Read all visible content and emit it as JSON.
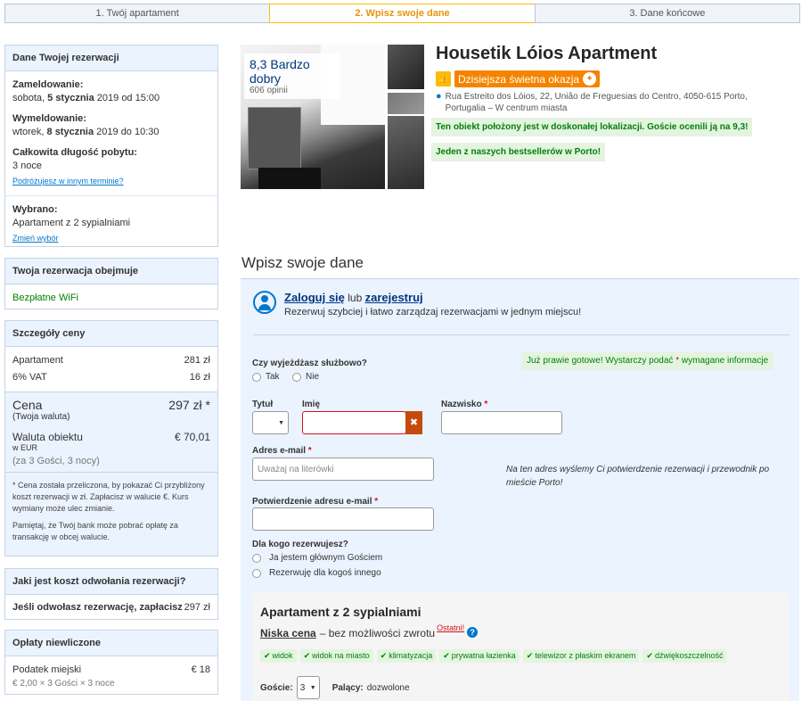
{
  "steps": [
    {
      "label": "1. Twój apartament"
    },
    {
      "label": "2. Wpisz swoje dane"
    },
    {
      "label": "3. Dane końcowe"
    }
  ],
  "reservation": {
    "title": "Dane Twojej rezerwacji",
    "checkin_label": "Zameldowanie:",
    "checkin_pre": "sobota, ",
    "checkin_date": "5 stycznia",
    "checkin_post": " 2019 od 15:00",
    "checkout_label": "Wymeldowanie:",
    "checkout_pre": "wtorek, ",
    "checkout_date": "8 stycznia",
    "checkout_post": " 2019 do 10:30",
    "length_label": "Całkowita długość pobytu:",
    "length_value": "3 noce",
    "other_dates_link": "Podróżujesz w innym terminie?",
    "chosen_label": "Wybrano:",
    "chosen_value": "Apartament z 2 sypialniami",
    "change_link": "Zmień wybór"
  },
  "includes": {
    "title": "Twoja rezerwacja obejmuje",
    "item": "Bezpłatne WiFi"
  },
  "price": {
    "title": "Szczegóły ceny",
    "rows": [
      {
        "label": "Apartament",
        "value": "281 zł"
      },
      {
        "label": "6% VAT",
        "value": "16 zł"
      }
    ],
    "total_label": "Cena",
    "total_sub": "(Twoja waluta)",
    "total_value": "297 zł *",
    "prop_currency_label": "Waluta obiektu",
    "prop_currency_sub": "w EUR",
    "prop_currency_value": "€ 70,01",
    "guests_nights": "(za 3 Gości, 3 nocy)",
    "note1": "* Cena została przeliczona, by pokazać Ci przybliżony koszt rezerwacji w zł. Zapłacisz w walucie €. Kurs wymiany może ulec zmianie.",
    "note2": "Pamiętaj, że Twój bank może pobrać opłatę za transakcję w obcej walucie."
  },
  "cancellation": {
    "title": "Jaki jest koszt odwołania rezerwacji?",
    "label": "Jeśli odwołasz rezerwację, zapłacisz",
    "value": "297 zł"
  },
  "fees": {
    "title": "Opłaty niewliczone",
    "label": "Podatek miejski",
    "value": "€ 18",
    "calc": "€ 2,00  ×  3 Gości  ×  3 noce"
  },
  "hotel": {
    "rating": "8,3 Bardzo dobry",
    "reviews": "606 opinii",
    "name": "Housetik Lóios Apartment",
    "deal": "Dzisiejsza świetna okazja",
    "address": "Rua Estreito dos Lóios, 22, União de Freguesias do Centro, 4050-615 Porto, Portugalia – W centrum miasta",
    "location_note": "Ten obiekt położony jest w doskonałej lokalizacji. Goście ocenili ją na 9,3!",
    "bestseller": "Jeden z naszych bestsellerów w Porto!"
  },
  "form": {
    "title": "Wpisz swoje dane",
    "login_link": "Zaloguj się",
    "or": " lub ",
    "register_link": "zarejestruj",
    "login_sub": "Rezerwuj szybciej i łatwo zarządzaj rezerwacjami w jednym miejscu!",
    "business_q": "Czy wyjeżdżasz służbowo?",
    "yes": "Tak",
    "no": "Nie",
    "ready_pre": "Już prawie gotowe! Wystarczy podać ",
    "ready_star": "*",
    "ready_post": " wymagane informacje",
    "title_label": "Tytuł",
    "firstname_label": "Imię",
    "lastname_label": "Nazwisko",
    "req_mark": " *",
    "email_label": "Adres e-mail",
    "email_placeholder": "Uważaj na literówki",
    "email_hint": "Na ten adres wyślemy Ci potwierdzenie rezerwacji i przewodnik po mieście Porto!",
    "email_confirm_label": "Potwierdzenie adresu e-mail",
    "for_whom_q": "Dla kogo rezerwujesz?",
    "for_me": "Ja jestem głównym Gościem",
    "for_other": "Rezerwuję dla kogoś innego",
    "error_icon": "✖"
  },
  "room": {
    "title": "Apartament z 2 sypialniami",
    "rate_name": "Niska cena",
    "rate_desc": " – bez możliwości zwrotu",
    "last_badge": "Ostatni!",
    "facilities": [
      "widok",
      "widok na miasto",
      "klimatyzacja",
      "prywatna łazienka",
      "telewizor z płaskim ekranem",
      "dźwiękoszczelność"
    ],
    "guests_label": "Goście:",
    "guests_value": "3",
    "smoking_label": "Palący:",
    "smoking_value": "dozwolone"
  },
  "colors": {
    "accent": "#febb02",
    "link": "#0077cc",
    "brand": "#003580",
    "success": "#008009",
    "error": "#d4111e"
  }
}
